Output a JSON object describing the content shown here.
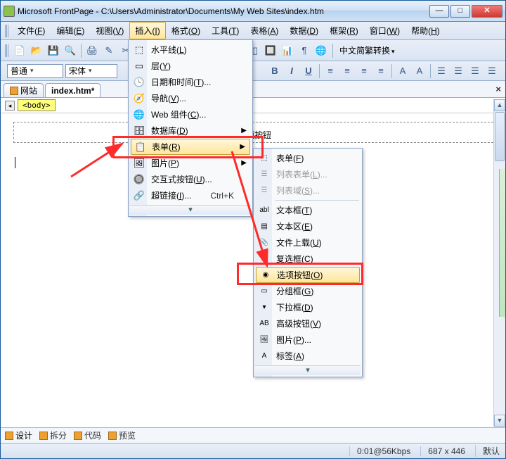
{
  "title": "Microsoft FrontPage - C:\\Users\\Administrator\\Documents\\My Web Sites\\index.htm",
  "menubar": {
    "items": [
      {
        "label": "文件(",
        "u": "F",
        "tail": ")"
      },
      {
        "label": "编辑(",
        "u": "E",
        "tail": ")"
      },
      {
        "label": "视图(",
        "u": "V",
        "tail": ")"
      },
      {
        "label": "插入(",
        "u": "I",
        "tail": ")",
        "open": true
      },
      {
        "label": "格式(",
        "u": "O",
        "tail": ")"
      },
      {
        "label": "工具(",
        "u": "T",
        "tail": ")"
      },
      {
        "label": "表格(",
        "u": "A",
        "tail": ")"
      },
      {
        "label": "数据(",
        "u": "D",
        "tail": ")"
      },
      {
        "label": "框架(",
        "u": "R",
        "tail": ")"
      },
      {
        "label": "窗口(",
        "u": "W",
        "tail": ")"
      },
      {
        "label": "帮助(",
        "u": "H",
        "tail": ")"
      }
    ]
  },
  "toolbar": {
    "btns": [
      "📄",
      "📂",
      "💾",
      "🔍",
      "🖨",
      "✎",
      "✂",
      "📋",
      "📋",
      "✓",
      "↶",
      "↷",
      "▦",
      "◫",
      "🔲",
      "📊",
      "¶",
      "🌐"
    ],
    "enc_label": "中文简繁转换"
  },
  "fmtbar": {
    "style_label": "普通",
    "font_label": "宋体",
    "btns": [
      "B",
      "I",
      "U",
      "≡",
      "≡",
      "≡",
      "≡",
      "A",
      "A",
      "☰",
      "☰",
      "☰",
      "☰"
    ]
  },
  "tabs": {
    "site": "网站",
    "file": "index.htm*"
  },
  "breadcrumb": {
    "tag": "<body>"
  },
  "page": {
    "heading_fragment": "选项按钮"
  },
  "insert_menu": {
    "items": [
      {
        "ico": "⬚",
        "label": "水平线(",
        "u": "L",
        "tail": ")"
      },
      {
        "ico": "▭",
        "label": "层(",
        "u": "Y",
        "tail": ")"
      },
      {
        "ico": "🕓",
        "label": "日期和时间(",
        "u": "T",
        "tail": ")..."
      },
      {
        "ico": "🧭",
        "label": "导航(",
        "u": "V",
        "tail": ")..."
      },
      {
        "ico": "🌐",
        "label": "Web 组件(",
        "u": "C",
        "tail": ")..."
      },
      {
        "ico": "🗄",
        "label": "数据库(",
        "u": "D",
        "tail": ")",
        "sub": true
      },
      {
        "ico": "📋",
        "label": "表单(",
        "u": "R",
        "tail": ")",
        "sub": true,
        "hl": true
      },
      {
        "ico": "🖼",
        "label": "图片(",
        "u": "P",
        "tail": ")",
        "sub": true
      },
      {
        "ico": "🔘",
        "label": "交互式按钮(",
        "u": "U",
        "tail": ")..."
      },
      {
        "ico": "🔗",
        "label": "超链接(",
        "u": "I",
        "tail": ")...",
        "shortcut": "Ctrl+K"
      }
    ]
  },
  "form_submenu": {
    "items": [
      {
        "ico": "⬚",
        "label": "表单(",
        "u": "F",
        "tail": ")"
      },
      {
        "ico": "☰",
        "label": "列表表单(",
        "u": "L",
        "tail": ")...",
        "dis": true
      },
      {
        "ico": "☰",
        "label": "列表域(",
        "u": "S",
        "tail": ")...",
        "dis": true
      },
      {
        "sep": true
      },
      {
        "ico": "abl",
        "label": "文本框(",
        "u": "T",
        "tail": ")"
      },
      {
        "ico": "▤",
        "label": "文本区(",
        "u": "E",
        "tail": ")"
      },
      {
        "ico": "📎",
        "label": "文件上载(",
        "u": "U",
        "tail": ")"
      },
      {
        "ico": "☑",
        "label": "复选框(",
        "u": "C",
        "tail": ")"
      },
      {
        "ico": "◉",
        "label": "选项按钮(",
        "u": "O",
        "tail": ")",
        "hl": true
      },
      {
        "ico": "▭",
        "label": "分组框(",
        "u": "G",
        "tail": ")"
      },
      {
        "ico": "▾",
        "label": "下拉框(",
        "u": "D",
        "tail": ")"
      },
      {
        "ico": "AB",
        "label": "高级按钮(",
        "u": "V",
        "tail": ")"
      },
      {
        "ico": "🖼",
        "label": "图片(",
        "u": "P",
        "tail": ")..."
      },
      {
        "ico": "A",
        "label": "标签(",
        "u": "A",
        "tail": ")"
      }
    ]
  },
  "viewbar": {
    "items": [
      {
        "label": "设计",
        "sel": true
      },
      {
        "label": "拆分"
      },
      {
        "label": "代码"
      },
      {
        "label": "预览"
      }
    ]
  },
  "status": {
    "time": "0:01@56Kbps",
    "size": "687 x 446",
    "lang": "默认"
  }
}
